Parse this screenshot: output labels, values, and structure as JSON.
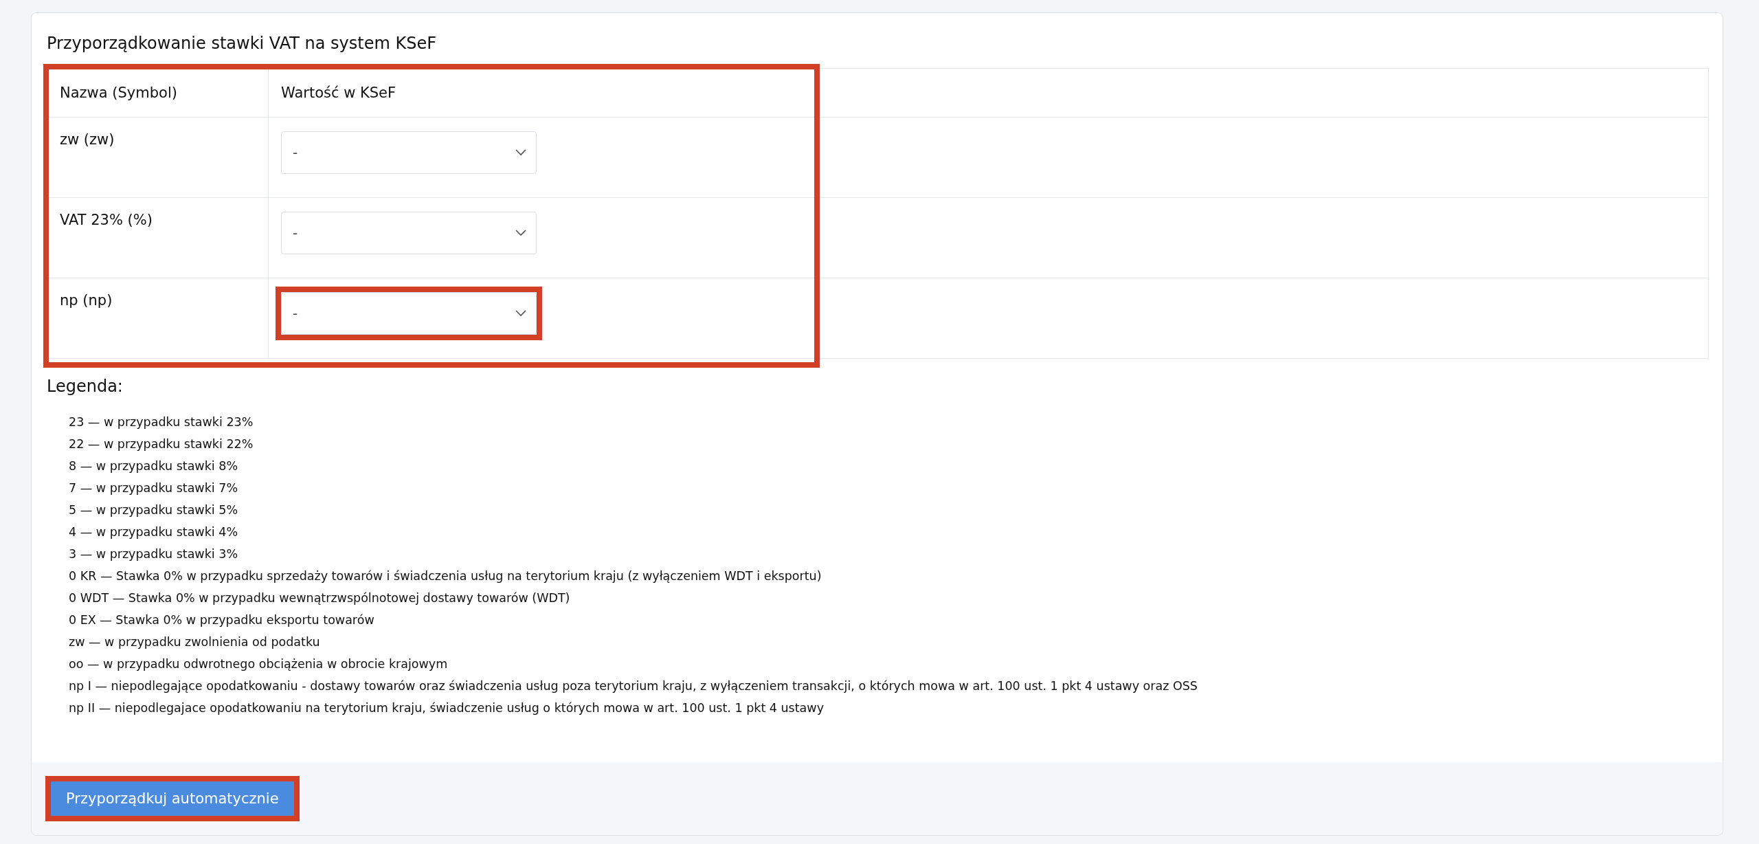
{
  "title": "Przyporządkowanie stawki VAT na system KSeF",
  "table": {
    "highlighted": true,
    "columns": [
      "Nazwa (Symbol)",
      "Wartość w KSeF"
    ],
    "rows": [
      {
        "name": "zw (zw)",
        "value": "-",
        "highlighted": false
      },
      {
        "name": "VAT 23% (%)",
        "value": "-",
        "highlighted": false
      },
      {
        "name": "np (np)",
        "value": "-",
        "highlighted": true
      }
    ]
  },
  "legend": {
    "title": "Legenda:",
    "items": [
      "23 — w przypadku stawki 23%",
      "22 — w przypadku stawki 22%",
      "8 — w przypadku stawki 8%",
      "7 — w przypadku stawki 7%",
      "5 — w przypadku stawki 5%",
      "4 — w przypadku stawki 4%",
      "3 — w przypadku stawki 3%",
      "0 KR — Stawka 0% w przypadku sprzedaży towarów i świadczenia usług na terytorium kraju (z wyłączeniem WDT i eksportu)",
      "0 WDT — Stawka 0% w przypadku wewnątrzwspólnotowej dostawy towarów (WDT)",
      "0 EX — Stawka 0% w przypadku eksportu towarów",
      "zw — w przypadku zwolnienia od podatku",
      "oo — w przypadku odwrotnego obciążenia w obrocie krajowym",
      "np I — niepodlegające opodatkowaniu - dostawy towarów oraz świadczenia usług poza terytorium kraju, z wyłączeniem transakcji, o których mowa w art. 100 ust. 1 pkt 4 ustawy oraz OSS",
      "np II — niepodlegajace opodatkowaniu na terytorium kraju, świadczenie usług o których mowa w art. 100 ust. 1 pkt 4 ustawy"
    ]
  },
  "button": {
    "label": "Przyporządkuj automatycznie",
    "highlighted": true
  }
}
